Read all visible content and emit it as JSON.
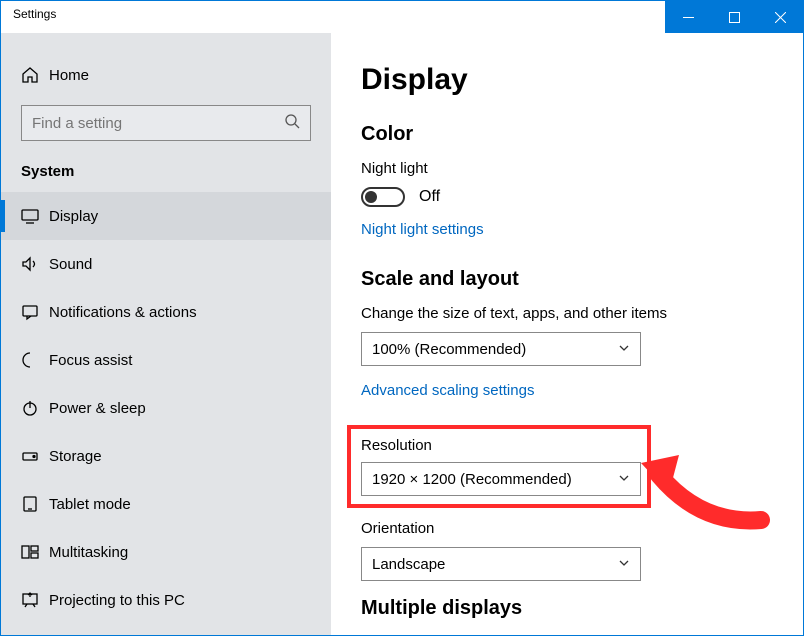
{
  "window": {
    "title": "Settings"
  },
  "sidebar": {
    "home": "Home",
    "search_placeholder": "Find a setting",
    "section": "System",
    "items": [
      {
        "label": "Display"
      },
      {
        "label": "Sound"
      },
      {
        "label": "Notifications & actions"
      },
      {
        "label": "Focus assist"
      },
      {
        "label": "Power & sleep"
      },
      {
        "label": "Storage"
      },
      {
        "label": "Tablet mode"
      },
      {
        "label": "Multitasking"
      },
      {
        "label": "Projecting to this PC"
      }
    ]
  },
  "content": {
    "heading": "Display",
    "color": {
      "heading": "Color",
      "night_light_label": "Night light",
      "night_light_state": "Off",
      "link": "Night light settings"
    },
    "scale": {
      "heading": "Scale and layout",
      "text_size_label": "Change the size of text, apps, and other items",
      "text_size_value": "100% (Recommended)",
      "advanced_link": "Advanced scaling settings",
      "resolution_label": "Resolution",
      "resolution_value": "1920 × 1200 (Recommended)",
      "orientation_label": "Orientation",
      "orientation_value": "Landscape"
    },
    "multiple": {
      "heading": "Multiple displays"
    }
  }
}
